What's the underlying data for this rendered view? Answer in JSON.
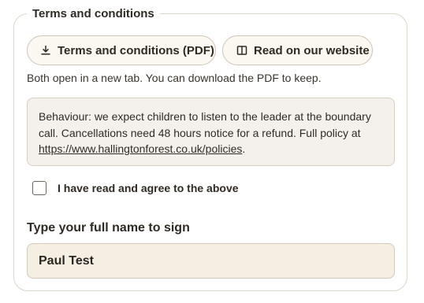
{
  "section": {
    "legend": "Terms and conditions"
  },
  "buttons": {
    "pdf_label": "Terms and conditions (PDF)",
    "pdf_icon": "download-icon",
    "website_label": "Read on our website",
    "website_icon": "book-open-icon"
  },
  "note": "Both open in a new tab. You can download the PDF to keep.",
  "policy": {
    "text": "Behaviour: we expect children to listen to the leader at the boundary call. Cancellations need 48 hours notice for a refund. Full policy at ",
    "link_text": "https://www.hallingtonforest.co.uk/policies",
    "suffix": "."
  },
  "agreement": {
    "label": "I have read and agree to the above",
    "checked": false
  },
  "signature": {
    "label": "Type your full name to sign",
    "value": "Paul Test"
  }
}
